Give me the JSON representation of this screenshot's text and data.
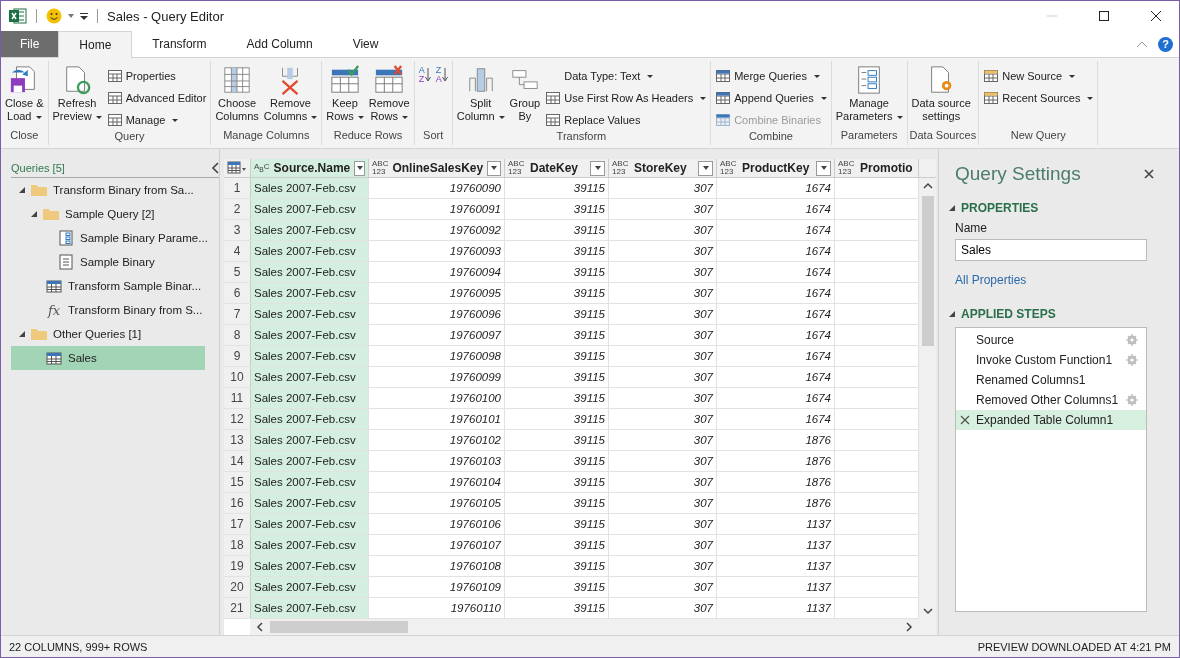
{
  "window": {
    "title": "Sales - Query Editor",
    "minimize_disabled": true
  },
  "ribbon_tabs": [
    {
      "label": "File",
      "kind": "file",
      "selected": false
    },
    {
      "label": "Home",
      "kind": "tab",
      "selected": true
    },
    {
      "label": "Transform",
      "kind": "tab",
      "selected": false
    },
    {
      "label": "Add Column",
      "kind": "tab",
      "selected": false
    },
    {
      "label": "View",
      "kind": "tab",
      "selected": false
    }
  ],
  "help": "?",
  "ribbon_groups": [
    {
      "label": "Close",
      "items": [
        {
          "kind": "large",
          "label": "Close &\nLoad",
          "dropdown": true,
          "disabled": false
        }
      ]
    },
    {
      "label": "Query",
      "items": [
        {
          "kind": "large",
          "label": "Refresh\nPreview",
          "dropdown": true,
          "disabled": false
        },
        {
          "kind": "small",
          "label": "Properties",
          "dropdown": false,
          "disabled": false
        },
        {
          "kind": "small",
          "label": "Advanced Editor",
          "dropdown": false,
          "disabled": false
        },
        {
          "kind": "small",
          "label": "Manage",
          "dropdown": true,
          "disabled": false
        }
      ]
    },
    {
      "label": "Manage Columns",
      "items": [
        {
          "kind": "large",
          "label": "Choose\nColumns",
          "dropdown": false,
          "disabled": false
        },
        {
          "kind": "large",
          "label": "Remove\nColumns",
          "dropdown": true,
          "disabled": false
        }
      ]
    },
    {
      "label": "Reduce Rows",
      "items": [
        {
          "kind": "large",
          "label": "Keep\nRows",
          "dropdown": true,
          "disabled": false
        },
        {
          "kind": "large",
          "label": "Remove\nRows",
          "dropdown": true,
          "disabled": false
        }
      ]
    },
    {
      "label": "Sort",
      "items": [
        {
          "kind": "sort",
          "glyph": "AZ",
          "disabled": false
        },
        {
          "kind": "sort",
          "glyph": "ZA",
          "disabled": false
        }
      ]
    },
    {
      "label": "Transform",
      "items": [
        {
          "kind": "large",
          "label": "Split\nColumn",
          "dropdown": true,
          "disabled": false
        },
        {
          "kind": "large",
          "label": "Group\nBy",
          "dropdown": false,
          "disabled": false
        },
        {
          "kind": "small",
          "label": "Data Type: Text",
          "dropdown": true,
          "disabled": false
        },
        {
          "kind": "small",
          "label": "Use First Row As Headers",
          "dropdown": true,
          "disabled": false
        },
        {
          "kind": "small",
          "label": "Replace Values",
          "dropdown": false,
          "disabled": false
        }
      ]
    },
    {
      "label": "Combine",
      "items": [
        {
          "kind": "small",
          "label": "Merge Queries",
          "dropdown": true,
          "disabled": false
        },
        {
          "kind": "small",
          "label": "Append Queries",
          "dropdown": true,
          "disabled": false
        },
        {
          "kind": "small",
          "label": "Combine Binaries",
          "dropdown": false,
          "disabled": true
        }
      ]
    },
    {
      "label": "Parameters",
      "items": [
        {
          "kind": "large",
          "label": "Manage\nParameters",
          "dropdown": true,
          "disabled": false
        }
      ]
    },
    {
      "label": "Data Sources",
      "items": [
        {
          "kind": "large",
          "label": "Data source\nsettings",
          "dropdown": false,
          "disabled": false
        }
      ]
    },
    {
      "label": "New Query",
      "items": [
        {
          "kind": "small",
          "label": "New Source",
          "dropdown": true,
          "disabled": false
        },
        {
          "kind": "small",
          "label": "Recent Sources",
          "dropdown": true,
          "disabled": false
        }
      ]
    }
  ],
  "queries_pane": {
    "title": "Queries [5]",
    "items": [
      {
        "kind": "folder",
        "label": "Transform Binary from Sa...",
        "expanded": true,
        "selected": false,
        "children": [
          {
            "kind": "folder",
            "label": "Sample Query [2]",
            "expanded": true,
            "selected": false,
            "children": [
              {
                "kind": "parameter",
                "label": "Sample Binary Parame...",
                "selected": false
              },
              {
                "kind": "list",
                "label": "Sample Binary",
                "selected": false
              }
            ]
          },
          {
            "kind": "table",
            "label": "Transform Sample Binar...",
            "selected": false
          },
          {
            "kind": "function",
            "glyph": "fx",
            "label": "Transform Binary from S...",
            "selected": false
          }
        ]
      },
      {
        "kind": "folder",
        "label": "Other Queries [1]",
        "expanded": true,
        "selected": false,
        "children": [
          {
            "kind": "table",
            "label": "Sales",
            "selected": true
          }
        ]
      }
    ]
  },
  "table": {
    "columns": [
      {
        "type": "A$_{B}$C",
        "name": "Source.Name",
        "selected": true
      },
      {
        "type": "ABC\n123",
        "name": "OnlineSalesKey",
        "selected": false
      },
      {
        "type": "ABC\n123",
        "name": "DateKey",
        "selected": false
      },
      {
        "type": "ABC\n123",
        "name": "StoreKey",
        "selected": false
      },
      {
        "type": "ABC\n123",
        "name": "ProductKey",
        "selected": false
      },
      {
        "type": "ABC\n123",
        "name": "Promotio",
        "selected": false
      }
    ],
    "rows": [
      {
        "n": "1",
        "cells": [
          "Sales 2007-Feb.csv",
          "19760090",
          "39115",
          "307",
          "1674"
        ]
      },
      {
        "n": "2",
        "cells": [
          "Sales 2007-Feb.csv",
          "19760091",
          "39115",
          "307",
          "1674"
        ]
      },
      {
        "n": "3",
        "cells": [
          "Sales 2007-Feb.csv",
          "19760092",
          "39115",
          "307",
          "1674"
        ]
      },
      {
        "n": "4",
        "cells": [
          "Sales 2007-Feb.csv",
          "19760093",
          "39115",
          "307",
          "1674"
        ]
      },
      {
        "n": "5",
        "cells": [
          "Sales 2007-Feb.csv",
          "19760094",
          "39115",
          "307",
          "1674"
        ]
      },
      {
        "n": "6",
        "cells": [
          "Sales 2007-Feb.csv",
          "19760095",
          "39115",
          "307",
          "1674"
        ]
      },
      {
        "n": "7",
        "cells": [
          "Sales 2007-Feb.csv",
          "19760096",
          "39115",
          "307",
          "1674"
        ]
      },
      {
        "n": "8",
        "cells": [
          "Sales 2007-Feb.csv",
          "19760097",
          "39115",
          "307",
          "1674"
        ]
      },
      {
        "n": "9",
        "cells": [
          "Sales 2007-Feb.csv",
          "19760098",
          "39115",
          "307",
          "1674"
        ]
      },
      {
        "n": "10",
        "cells": [
          "Sales 2007-Feb.csv",
          "19760099",
          "39115",
          "307",
          "1674"
        ]
      },
      {
        "n": "11",
        "cells": [
          "Sales 2007-Feb.csv",
          "19760100",
          "39115",
          "307",
          "1674"
        ]
      },
      {
        "n": "12",
        "cells": [
          "Sales 2007-Feb.csv",
          "19760101",
          "39115",
          "307",
          "1674"
        ]
      },
      {
        "n": "13",
        "cells": [
          "Sales 2007-Feb.csv",
          "19760102",
          "39115",
          "307",
          "1876"
        ]
      },
      {
        "n": "14",
        "cells": [
          "Sales 2007-Feb.csv",
          "19760103",
          "39115",
          "307",
          "1876"
        ]
      },
      {
        "n": "15",
        "cells": [
          "Sales 2007-Feb.csv",
          "19760104",
          "39115",
          "307",
          "1876"
        ]
      },
      {
        "n": "16",
        "cells": [
          "Sales 2007-Feb.csv",
          "19760105",
          "39115",
          "307",
          "1876"
        ]
      },
      {
        "n": "17",
        "cells": [
          "Sales 2007-Feb.csv",
          "19760106",
          "39115",
          "307",
          "1137"
        ]
      },
      {
        "n": "18",
        "cells": [
          "Sales 2007-Feb.csv",
          "19760107",
          "39115",
          "307",
          "1137"
        ]
      },
      {
        "n": "19",
        "cells": [
          "Sales 2007-Feb.csv",
          "19760108",
          "39115",
          "307",
          "1137"
        ]
      },
      {
        "n": "20",
        "cells": [
          "Sales 2007-Feb.csv",
          "19760109",
          "39115",
          "307",
          "1137"
        ]
      },
      {
        "n": "21",
        "cells": [
          "Sales 2007-Feb.csv",
          "19760110",
          "39115",
          "307",
          "1137"
        ]
      }
    ]
  },
  "query_settings": {
    "title": "Query Settings",
    "properties_header": "PROPERTIES",
    "name_label": "Name",
    "name_value": "Sales",
    "all_properties": "All Properties",
    "steps_header": "APPLIED STEPS",
    "steps": [
      {
        "label": "Source",
        "settings": true,
        "selected": false
      },
      {
        "label": "Invoke Custom Function1",
        "settings": true,
        "selected": false
      },
      {
        "label": "Renamed Columns1",
        "settings": false,
        "selected": false
      },
      {
        "label": "Removed Other Columns1",
        "settings": true,
        "selected": false
      },
      {
        "label": "Expanded Table Column1",
        "settings": false,
        "selected": true
      }
    ]
  },
  "status_bar": {
    "left": "22 COLUMNS, 999+ ROWS",
    "right": "PREVIEW DOWNLOADED AT 4:21 PM"
  }
}
